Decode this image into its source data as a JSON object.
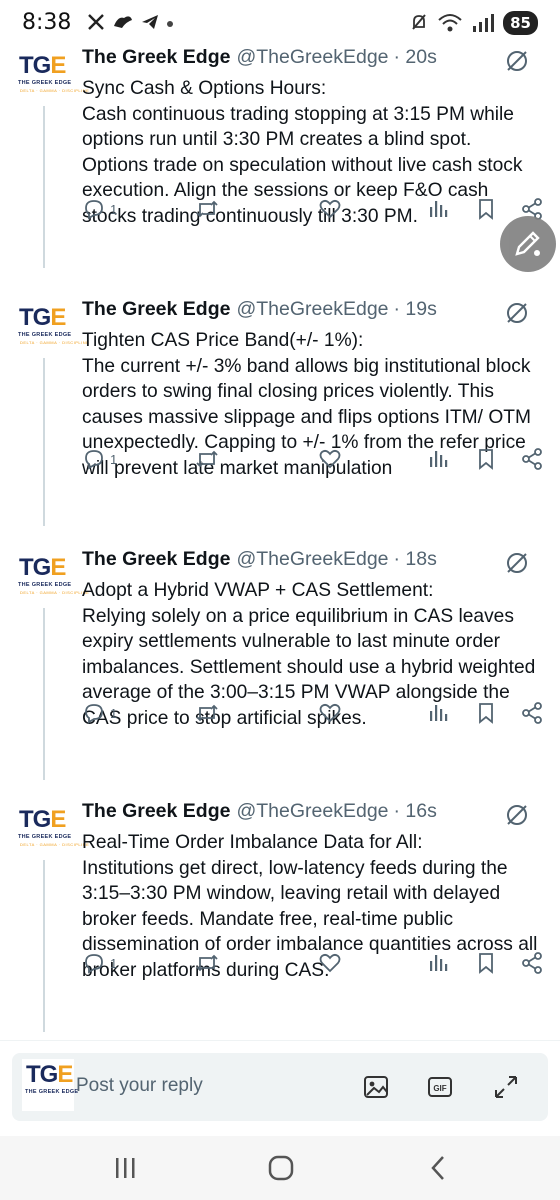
{
  "status_bar": {
    "time": "8:38",
    "battery": "85"
  },
  "tweets": [
    {
      "name": "The Greek Edge",
      "handle": "@TheGreekEdge",
      "age": "· 20s",
      "text": "Sync Cash & Options Hours:\nCash continuous trading stopping at 3:15 PM while options run until 3:30 PM creates a blind spot. Options trade on speculation without live cash stock execution. Align the sessions or keep F&O cash stocks trading continuously till 3:30 PM.",
      "replies": "1"
    },
    {
      "name": "The Greek Edge",
      "handle": "@TheGreekEdge",
      "age": "· 19s",
      "text": "Tighten CAS Price Band(+/- 1%):\nThe current +/- 3% band allows big institutional block orders to swing final closing prices violently. This causes massive slippage and flips options ITM/ OTM unexpectedly. Capping to +/- 1% from the refer price will prevent late market manipulation",
      "replies": "1"
    },
    {
      "name": "The Greek Edge",
      "handle": "@TheGreekEdge",
      "age": "· 18s",
      "text": "Adopt a Hybrid VWAP + CAS Settlement:\nRelying solely on a price equilibrium in CAS leaves expiry settlements vulnerable to last minute order imbalances. Settlement should use a hybrid weighted average of the 3:00–3:15 PM VWAP alongside the CAS price to stop artificial spikes.",
      "replies": "1"
    },
    {
      "name": "The Greek Edge",
      "handle": "@TheGreekEdge",
      "age": "· 16s",
      "text": "Real-Time Order Imbalance Data for All:\nInstitutions get direct, low-latency feeds during the 3:15–3:30 PM window, leaving retail with delayed broker feeds. Mandate free, real-time public dissemination of order imbalance quantities across all broker platforms during CAS.",
      "replies": "1"
    }
  ],
  "avatar": {
    "logo_text": "TGE",
    "logo_sub": "THE GREEK EDGE",
    "logo_sub2": "DELTA · GAMMA · DISCIPLINE"
  },
  "reply_bar": {
    "placeholder": "Post your reply"
  },
  "icons": {
    "reply": "reply-icon",
    "repost": "repost-icon",
    "like": "like-icon",
    "views": "views-icon",
    "bookmark": "bookmark-icon",
    "share": "share-icon",
    "grok": "grok-icon",
    "compose": "compose-fab-icon"
  },
  "colors": {
    "text": "#0f1419",
    "secondary": "#536471",
    "logo_navy": "#1a2a5c",
    "logo_gold": "#f0a020"
  }
}
